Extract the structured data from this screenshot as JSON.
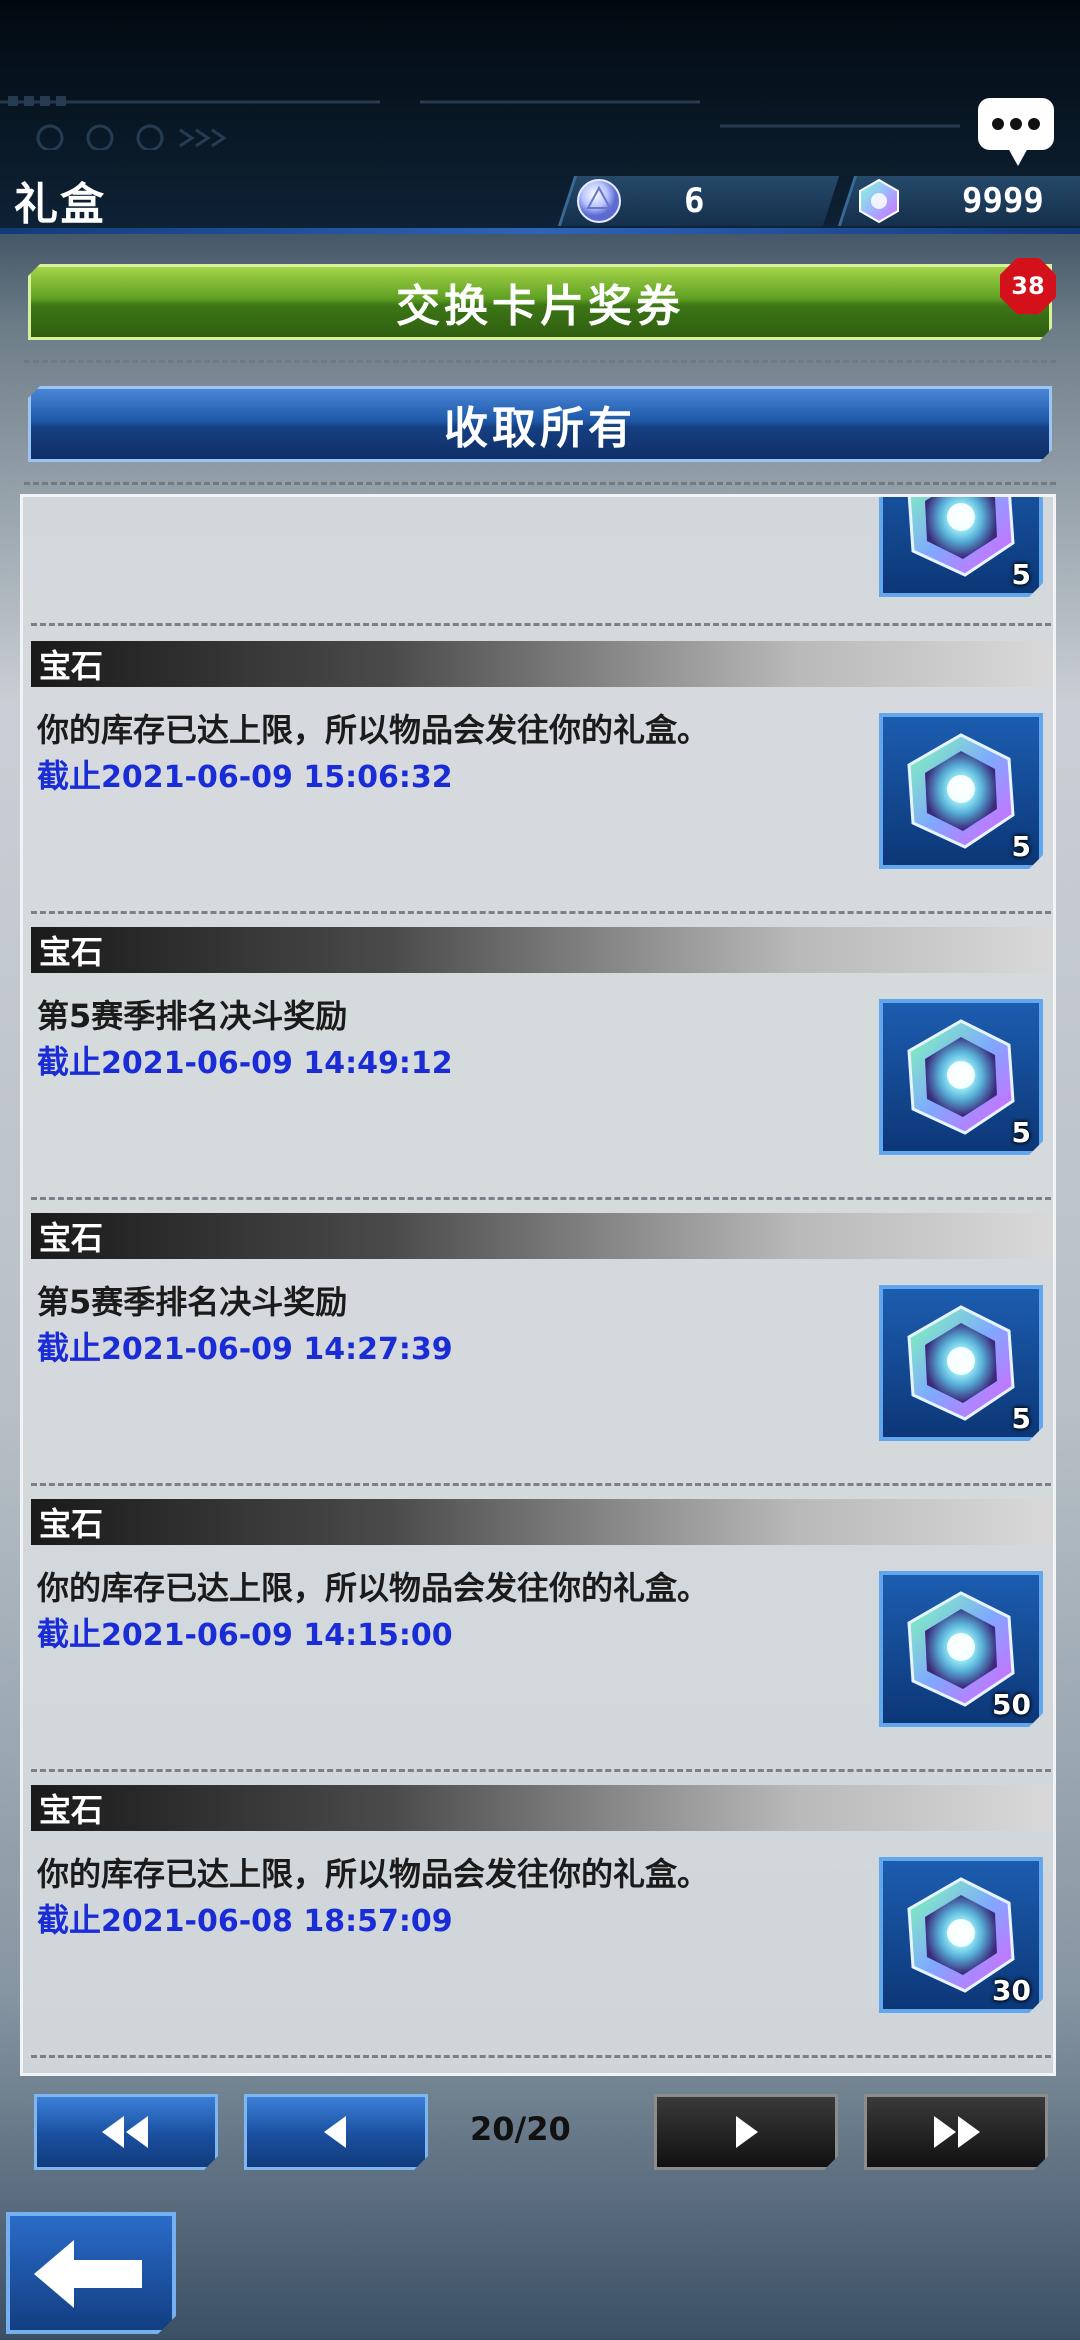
{
  "header": {
    "title": "礼盒",
    "currency_orbs": "6",
    "currency_gems": "9999"
  },
  "actions": {
    "exchange_label": "交换卡片奖券",
    "exchange_badge": "38",
    "collect_all_label": "收取所有"
  },
  "items": [
    {
      "category": "",
      "message": "",
      "deadline_label": "",
      "deadline": "",
      "quantity": "5",
      "partial": true
    },
    {
      "category": "宝石",
      "message": "你的库存已达上限，所以物品会发往你的礼盒。",
      "deadline_label": "截止",
      "deadline": "2021-06-09 15:06:32",
      "quantity": "5"
    },
    {
      "category": "宝石",
      "message": "第5赛季排名决斗奖励",
      "deadline_label": "截止",
      "deadline": "2021-06-09 14:49:12",
      "quantity": "5"
    },
    {
      "category": "宝石",
      "message": "第5赛季排名决斗奖励",
      "deadline_label": "截止",
      "deadline": "2021-06-09 14:27:39",
      "quantity": "5"
    },
    {
      "category": "宝石",
      "message": "你的库存已达上限，所以物品会发往你的礼盒。",
      "deadline_label": "截止",
      "deadline": "2021-06-09 14:15:00",
      "quantity": "50"
    },
    {
      "category": "宝石",
      "message": "你的库存已达上限，所以物品会发往你的礼盒。",
      "deadline_label": "截止",
      "deadline": "2021-06-08 18:57:09",
      "quantity": "30"
    }
  ],
  "pagination": {
    "page_text": "20/20"
  },
  "colors": {
    "deadline": "#1a2cd6",
    "exchange_green": "#4c8c1a",
    "collect_blue": "#1a4f9e",
    "badge_red": "#d4101b"
  }
}
